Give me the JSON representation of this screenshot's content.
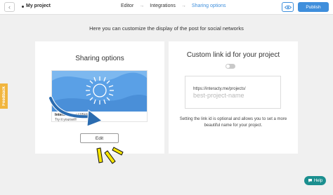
{
  "header": {
    "back_icon": "chevron-left-icon",
    "project_title": "My project",
    "steps": [
      {
        "label": "Editor",
        "active": false
      },
      {
        "label": "Integrations",
        "active": false
      },
      {
        "label": "Sharing options",
        "active": true
      }
    ],
    "step_arrow": "→",
    "preview_icon": "eye-icon",
    "publish_label": "Publish"
  },
  "headline": "Here you can customize the display of the post for social networks",
  "sharing_card": {
    "title": "Sharing options",
    "preview": {
      "title": "Interactive content",
      "subtitle": "Try it yourself!"
    },
    "edit_label": "Edit"
  },
  "link_card": {
    "title": "Custom link id for your project",
    "toggle_on": false,
    "url_prefix": "https://interacty.me/projects/",
    "input_placeholder": "best-project-name",
    "note": "Setting the link id is optional and allows you to set a more beautiful name for your project."
  },
  "feedback_label": "Feedback",
  "help_label": "Help",
  "colors": {
    "accent": "#3f8fdc",
    "feedback": "#f1b53e",
    "help": "#1b8f8f",
    "annotation_arrow": "#2b6cb0",
    "annotation_marks": "#f5e400"
  }
}
